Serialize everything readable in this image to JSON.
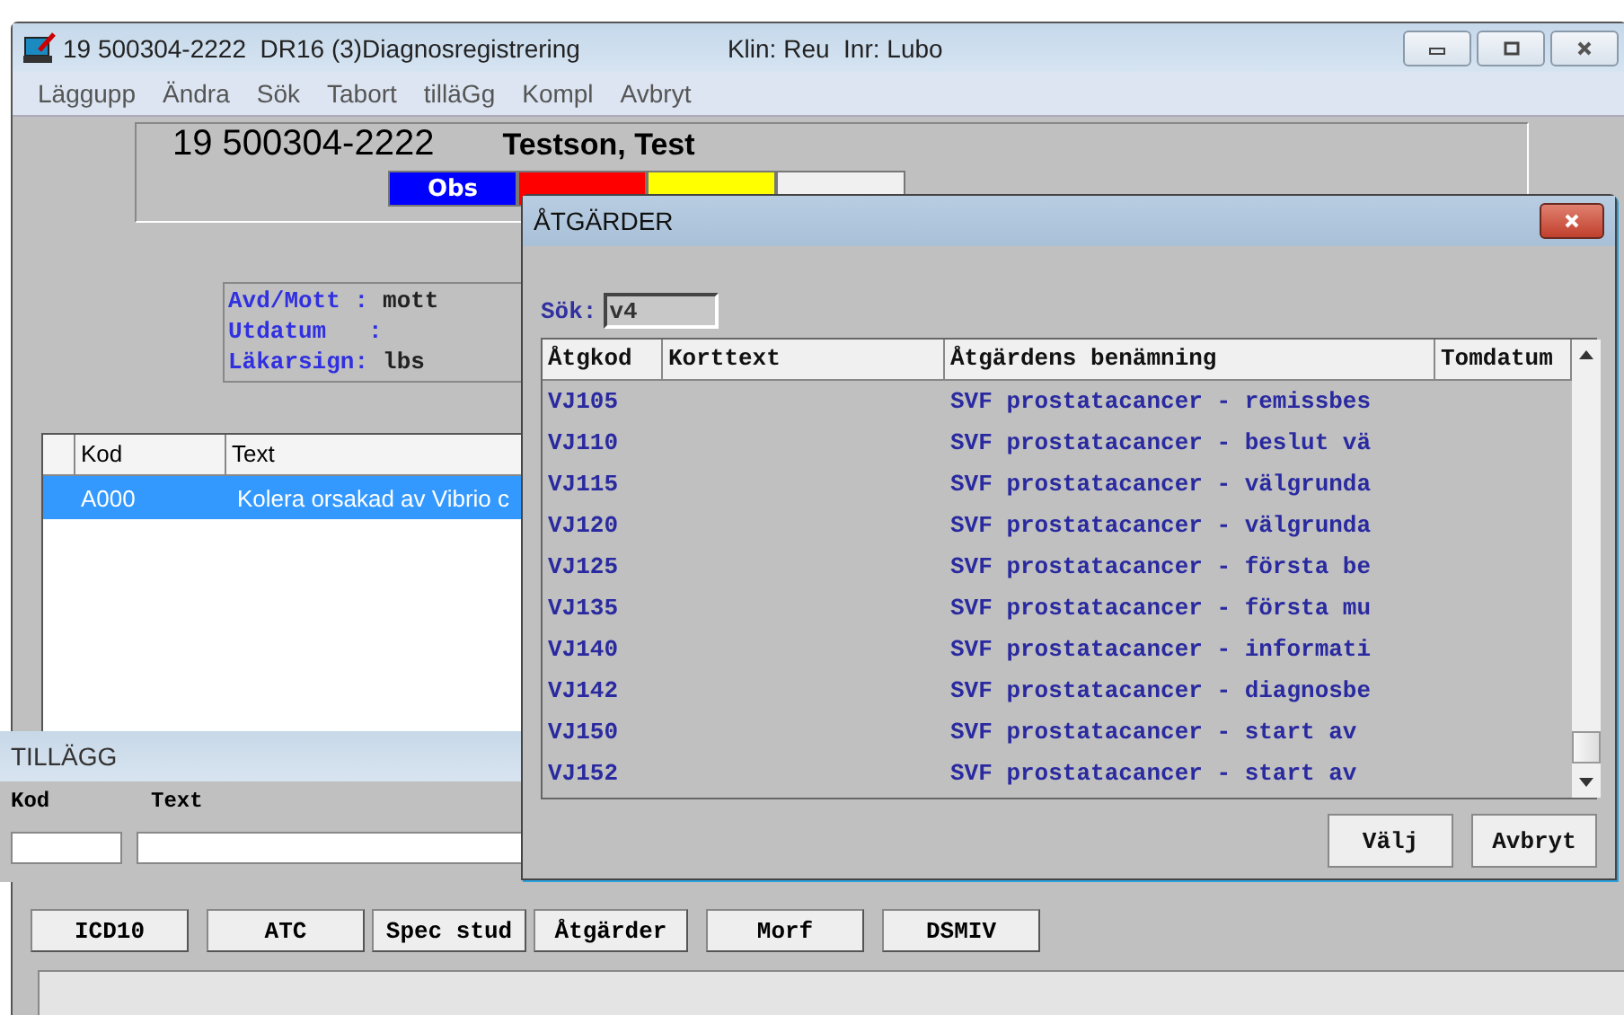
{
  "window": {
    "title": "19 500304-2222  DR16 (3)Diagnosregistrering",
    "context": "Klin: Reu  Inr: Lubo"
  },
  "menu": [
    "Läggupp",
    "Ändra",
    "Sök",
    "Tabort",
    "tilläGg",
    "Kompl",
    "Avbryt"
  ],
  "patient": {
    "id": "19 500304-2222",
    "name": "Testson, Test",
    "flags": [
      {
        "label": "Obs",
        "color": "#0000ff"
      },
      {
        "color": "#ff0000"
      },
      {
        "color": "#ffff00"
      },
      {
        "color": "#f0f0f0"
      }
    ]
  },
  "info": [
    {
      "label": "Avd/Mott :",
      "value": "mott"
    },
    {
      "label": "Utdatum   :"
    },
    {
      "label": "Läkarsign:",
      "value": "lbs"
    }
  ],
  "diagnoses": {
    "columns": [
      "Kod",
      "Text"
    ],
    "rows": [
      {
        "kod": "A000",
        "text": "Kolera orsakad av Vibrio c",
        "selected": true
      }
    ]
  },
  "addition": {
    "title": "TILLÄGG",
    "labels": [
      "Kod",
      "Text"
    ]
  },
  "buttons": [
    "ICD10",
    "ATC",
    "Spec stud",
    "Åtgärder",
    "Morf",
    "DSMIV"
  ],
  "dialog": {
    "title": "ÅTGÄRDER",
    "search": {
      "label": "Sök:",
      "value": "v4"
    },
    "columns": [
      "Åtgkod",
      "Korttext",
      "Åtgärdens benämning",
      "Tomdatum"
    ],
    "rows": [
      {
        "code": "VJ105",
        "name": "SVF prostatacancer - remissbes"
      },
      {
        "code": "VJ110",
        "name": "SVF prostatacancer - beslut vä"
      },
      {
        "code": "VJ115",
        "name": "SVF prostatacancer - välgrunda"
      },
      {
        "code": "VJ120",
        "name": "SVF prostatacancer - välgrunda"
      },
      {
        "code": "VJ125",
        "name": "SVF prostatacancer - första be"
      },
      {
        "code": "VJ135",
        "name": "SVF prostatacancer - första mu"
      },
      {
        "code": "VJ140",
        "name": "SVF prostatacancer - informati"
      },
      {
        "code": "VJ142",
        "name": "SVF prostatacancer - diagnosbe"
      },
      {
        "code": "VJ150",
        "name": "SVF prostatacancer - start av"
      },
      {
        "code": "VJ152",
        "name": "SVF prostatacancer - start av"
      }
    ],
    "buttons": [
      "Välj",
      "Avbryt"
    ]
  }
}
